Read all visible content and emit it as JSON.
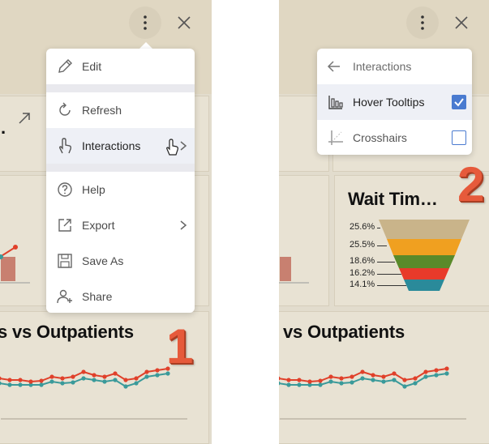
{
  "colors": {
    "panel_bg": "#e2dccd",
    "card_bg": "#e8e2d3",
    "accent": "#4a7bd0",
    "step_number": "#e65a3b",
    "series_red": "#e0402a",
    "series_teal": "#3a9a9a"
  },
  "panel1": {
    "kebab_icon": "more-vertical-icon",
    "close_icon": "close-icon",
    "menu": [
      {
        "label": "Edit",
        "icon": "pencil-icon"
      },
      {
        "label": "Refresh",
        "icon": "refresh-icon"
      },
      {
        "label": "Interactions",
        "icon": "hand-pointer-icon",
        "submenu": true
      },
      {
        "label": "Help",
        "icon": "help-circle-icon"
      },
      {
        "label": "Export",
        "icon": "export-icon",
        "submenu": true
      },
      {
        "label": "Save As",
        "icon": "save-icon"
      },
      {
        "label": "Share",
        "icon": "add-user-icon"
      }
    ],
    "chart_title": "s vs Outpatients",
    "step_number": "1"
  },
  "panel2": {
    "submenu": {
      "title": "Interactions",
      "back_icon": "arrow-left-icon",
      "options": [
        {
          "label": "Hover Tooltips",
          "icon": "bar-chart-icon",
          "checked": true
        },
        {
          "label": "Crosshairs",
          "icon": "crosshair-icon",
          "checked": false
        }
      ]
    },
    "funnel_title": "Wait Tim…",
    "funnel_values": [
      "25.6%",
      "25.5%",
      "18.6%",
      "16.2%",
      "14.1%"
    ],
    "funnel_colors": [
      "#c9b48a",
      "#f0a020",
      "#5a8a2a",
      "#e83a2a",
      "#2a8a9a"
    ],
    "chart_title": "vs Outpatients",
    "step_number": "2"
  }
}
